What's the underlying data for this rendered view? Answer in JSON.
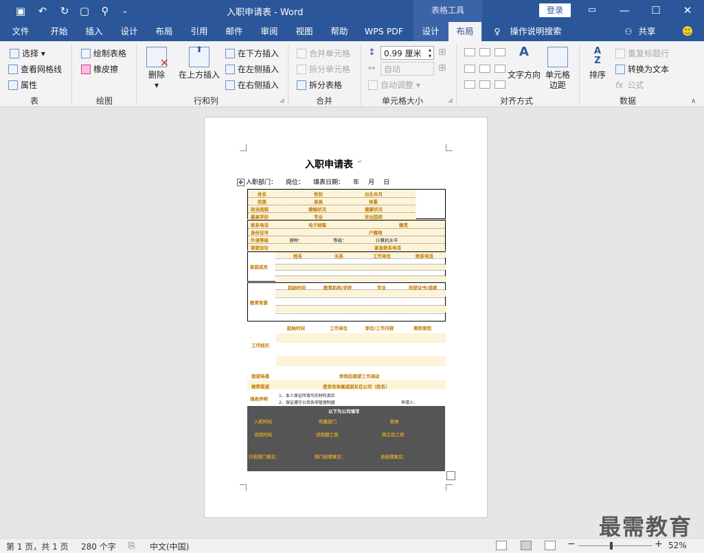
{
  "window": {
    "title": "入职申请表  -  Word",
    "context_tool": "表格工具",
    "login_label": "登录"
  },
  "tabs": [
    "文件",
    "开始",
    "插入",
    "设计",
    "布局",
    "引用",
    "邮件",
    "审阅",
    "视图",
    "帮助",
    "WPS PDF",
    "设计",
    "布局"
  ],
  "tell_me": "操作说明搜索",
  "share": "共享",
  "ribbon": {
    "table_group": {
      "label": "表",
      "select": "选择",
      "gridlines": "查看网格线",
      "properties": "属性"
    },
    "draw_group": {
      "label": "绘图",
      "draw_table": "绘制表格",
      "eraser": "橡皮擦"
    },
    "rows_group": {
      "label": "行和列",
      "delete": "删除",
      "insert_above": "在上方插入",
      "insert_below": "在下方插入",
      "insert_left": "在左侧插入",
      "insert_right": "在右侧插入"
    },
    "merge_group": {
      "label": "合并",
      "merge_cells": "合并单元格",
      "split_cells": "拆分单元格",
      "split_table": "拆分表格"
    },
    "size_group": {
      "label": "单元格大小",
      "height_value": "0.99 厘米",
      "width_value": "自动",
      "autofit": "自动调整"
    },
    "align_group": {
      "label": "对齐方式",
      "text_direction": "文字方向",
      "cell_margins_1": "单元格",
      "cell_margins_2": "边距"
    },
    "data_group": {
      "label": "数据",
      "sort": "排序",
      "repeat_header": "重复标题行",
      "convert_text": "转换为文本",
      "formula": "公式"
    }
  },
  "document": {
    "title": "入职申请表",
    "header_line": [
      "入职部门：",
      "岗位：",
      "填表日期：",
      "年",
      "月",
      "日"
    ],
    "basic": {
      "row1": [
        "姓名",
        "性别",
        "出生年月"
      ],
      "row2": [
        "民族",
        "身高",
        "体重"
      ],
      "row3": [
        "政治面貌",
        "婚姻状况",
        "健康状况"
      ],
      "row4": [
        "最高学历",
        "专业",
        "毕业院校"
      ]
    },
    "contact": {
      "row1": [
        "联系电话",
        "电子邮箱",
        "籍贯"
      ],
      "row2": [
        "身份证号",
        "户籍地"
      ],
      "row3": [
        "外语等级",
        "语种：",
        "等级：",
        "计算机水平"
      ],
      "row4": [
        "家庭住址",
        "紧急联系电话"
      ]
    },
    "family": {
      "label": "家庭成员",
      "cols": [
        "姓名",
        "关系",
        "工作单位",
        "联系电话"
      ]
    },
    "education": {
      "label": "教育背景",
      "cols": [
        "起始时间",
        "教育机构/学校",
        "专业",
        "所获证书/成绩"
      ]
    },
    "work": {
      "label": "工作经历",
      "cols": [
        "起始时间",
        "工作单位",
        "职位/工作内容",
        "离职原因"
      ]
    },
    "expected": {
      "label": "期望待遇",
      "text": "转岗后期望工作调动"
    },
    "relations": {
      "label": "推荐渠道",
      "text": "是否有亲属或朋友在公司（姓名）"
    },
    "declaration": {
      "label": "填表声明",
      "line1": "1、本人保证所填写的材料真实",
      "line2": "2、保证遵守公司各项管理制度",
      "signer": "申请人："
    },
    "company": {
      "header": "以下为公司填写",
      "row1": [
        "入职时间",
        "所属部门",
        "职务"
      ],
      "row2": [
        "试用时间",
        "试用期工资",
        "转正后工资"
      ],
      "row3": [
        "行政部门意见：",
        "部门经理意见：",
        "总经理意见："
      ]
    }
  },
  "status": {
    "page": "第 1 页，共 1 页",
    "words": "280 个字",
    "lang": "中文(中国)",
    "zoom": "52%"
  },
  "watermark": "最需教育"
}
